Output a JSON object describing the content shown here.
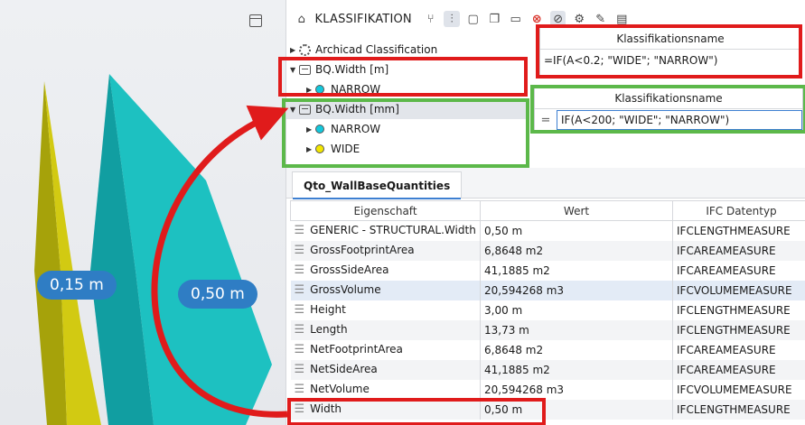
{
  "viewport": {
    "labels": [
      "0,15 m",
      "0,50 m"
    ]
  },
  "panel": {
    "title": "KLASSIFIKATION",
    "tree": [
      {
        "caret": "▶",
        "icon": "gear-node",
        "label": "Archicad Classification",
        "depth": 0
      },
      {
        "caret": "▼",
        "icon": "classification-node",
        "label": "BQ.Width [m]",
        "depth": 0
      },
      {
        "caret": "▶",
        "icon": "dot",
        "color": "#13c8dc",
        "label": "NARROW",
        "depth": 1
      },
      {
        "caret": "▼",
        "icon": "classification-node",
        "label": "BQ.Width [mm]",
        "depth": 0,
        "selected": true
      },
      {
        "caret": "▶",
        "icon": "dot",
        "color": "#13c8dc",
        "label": "NARROW",
        "depth": 1
      },
      {
        "caret": "▶",
        "icon": "dot",
        "color": "#f2e600",
        "label": "WIDE",
        "depth": 1
      }
    ],
    "formula_m": {
      "header": "Klassifikationsname",
      "value": "=IF(A<0.2; \"WIDE\"; \"NARROW\")"
    },
    "formula_mm": {
      "header": "Klassifikationsname",
      "handle": "=",
      "value": "IF(A<200; \"WIDE\"; \"NARROW\")"
    },
    "tab": "Qto_WallBaseQuantities",
    "table": {
      "headers": [
        "Eigenschaft",
        "Wert",
        "IFC Datentyp"
      ],
      "rows": [
        [
          "GENERIC - STRUCTURAL.Width",
          "0,50 m",
          "IFCLENGTHMEASURE"
        ],
        [
          "GrossFootprintArea",
          "6,8648 m2",
          "IFCAREAMEASURE"
        ],
        [
          "GrossSideArea",
          "41,1885 m2",
          "IFCAREAMEASURE"
        ],
        [
          "GrossVolume",
          "20,594268 m3",
          "IFCVOLUMEMEASURE"
        ],
        [
          "Height",
          "3,00 m",
          "IFCLENGTHMEASURE"
        ],
        [
          "Length",
          "13,73 m",
          "IFCLENGTHMEASURE"
        ],
        [
          "NetFootprintArea",
          "6,8648 m2",
          "IFCAREAMEASURE"
        ],
        [
          "NetSideArea",
          "41,1885 m2",
          "IFCAREAMEASURE"
        ],
        [
          "NetVolume",
          "20,594268 m3",
          "IFCVOLUMEMEASURE"
        ],
        [
          "Width",
          "0,50 m",
          "IFCLENGTHMEASURE"
        ]
      ]
    }
  },
  "colors": {
    "accent": "#3d7fd1",
    "annotation_red": "#e01b1b",
    "annotation_green": "#5cb84a",
    "label_blue": "#2f7dc4"
  }
}
